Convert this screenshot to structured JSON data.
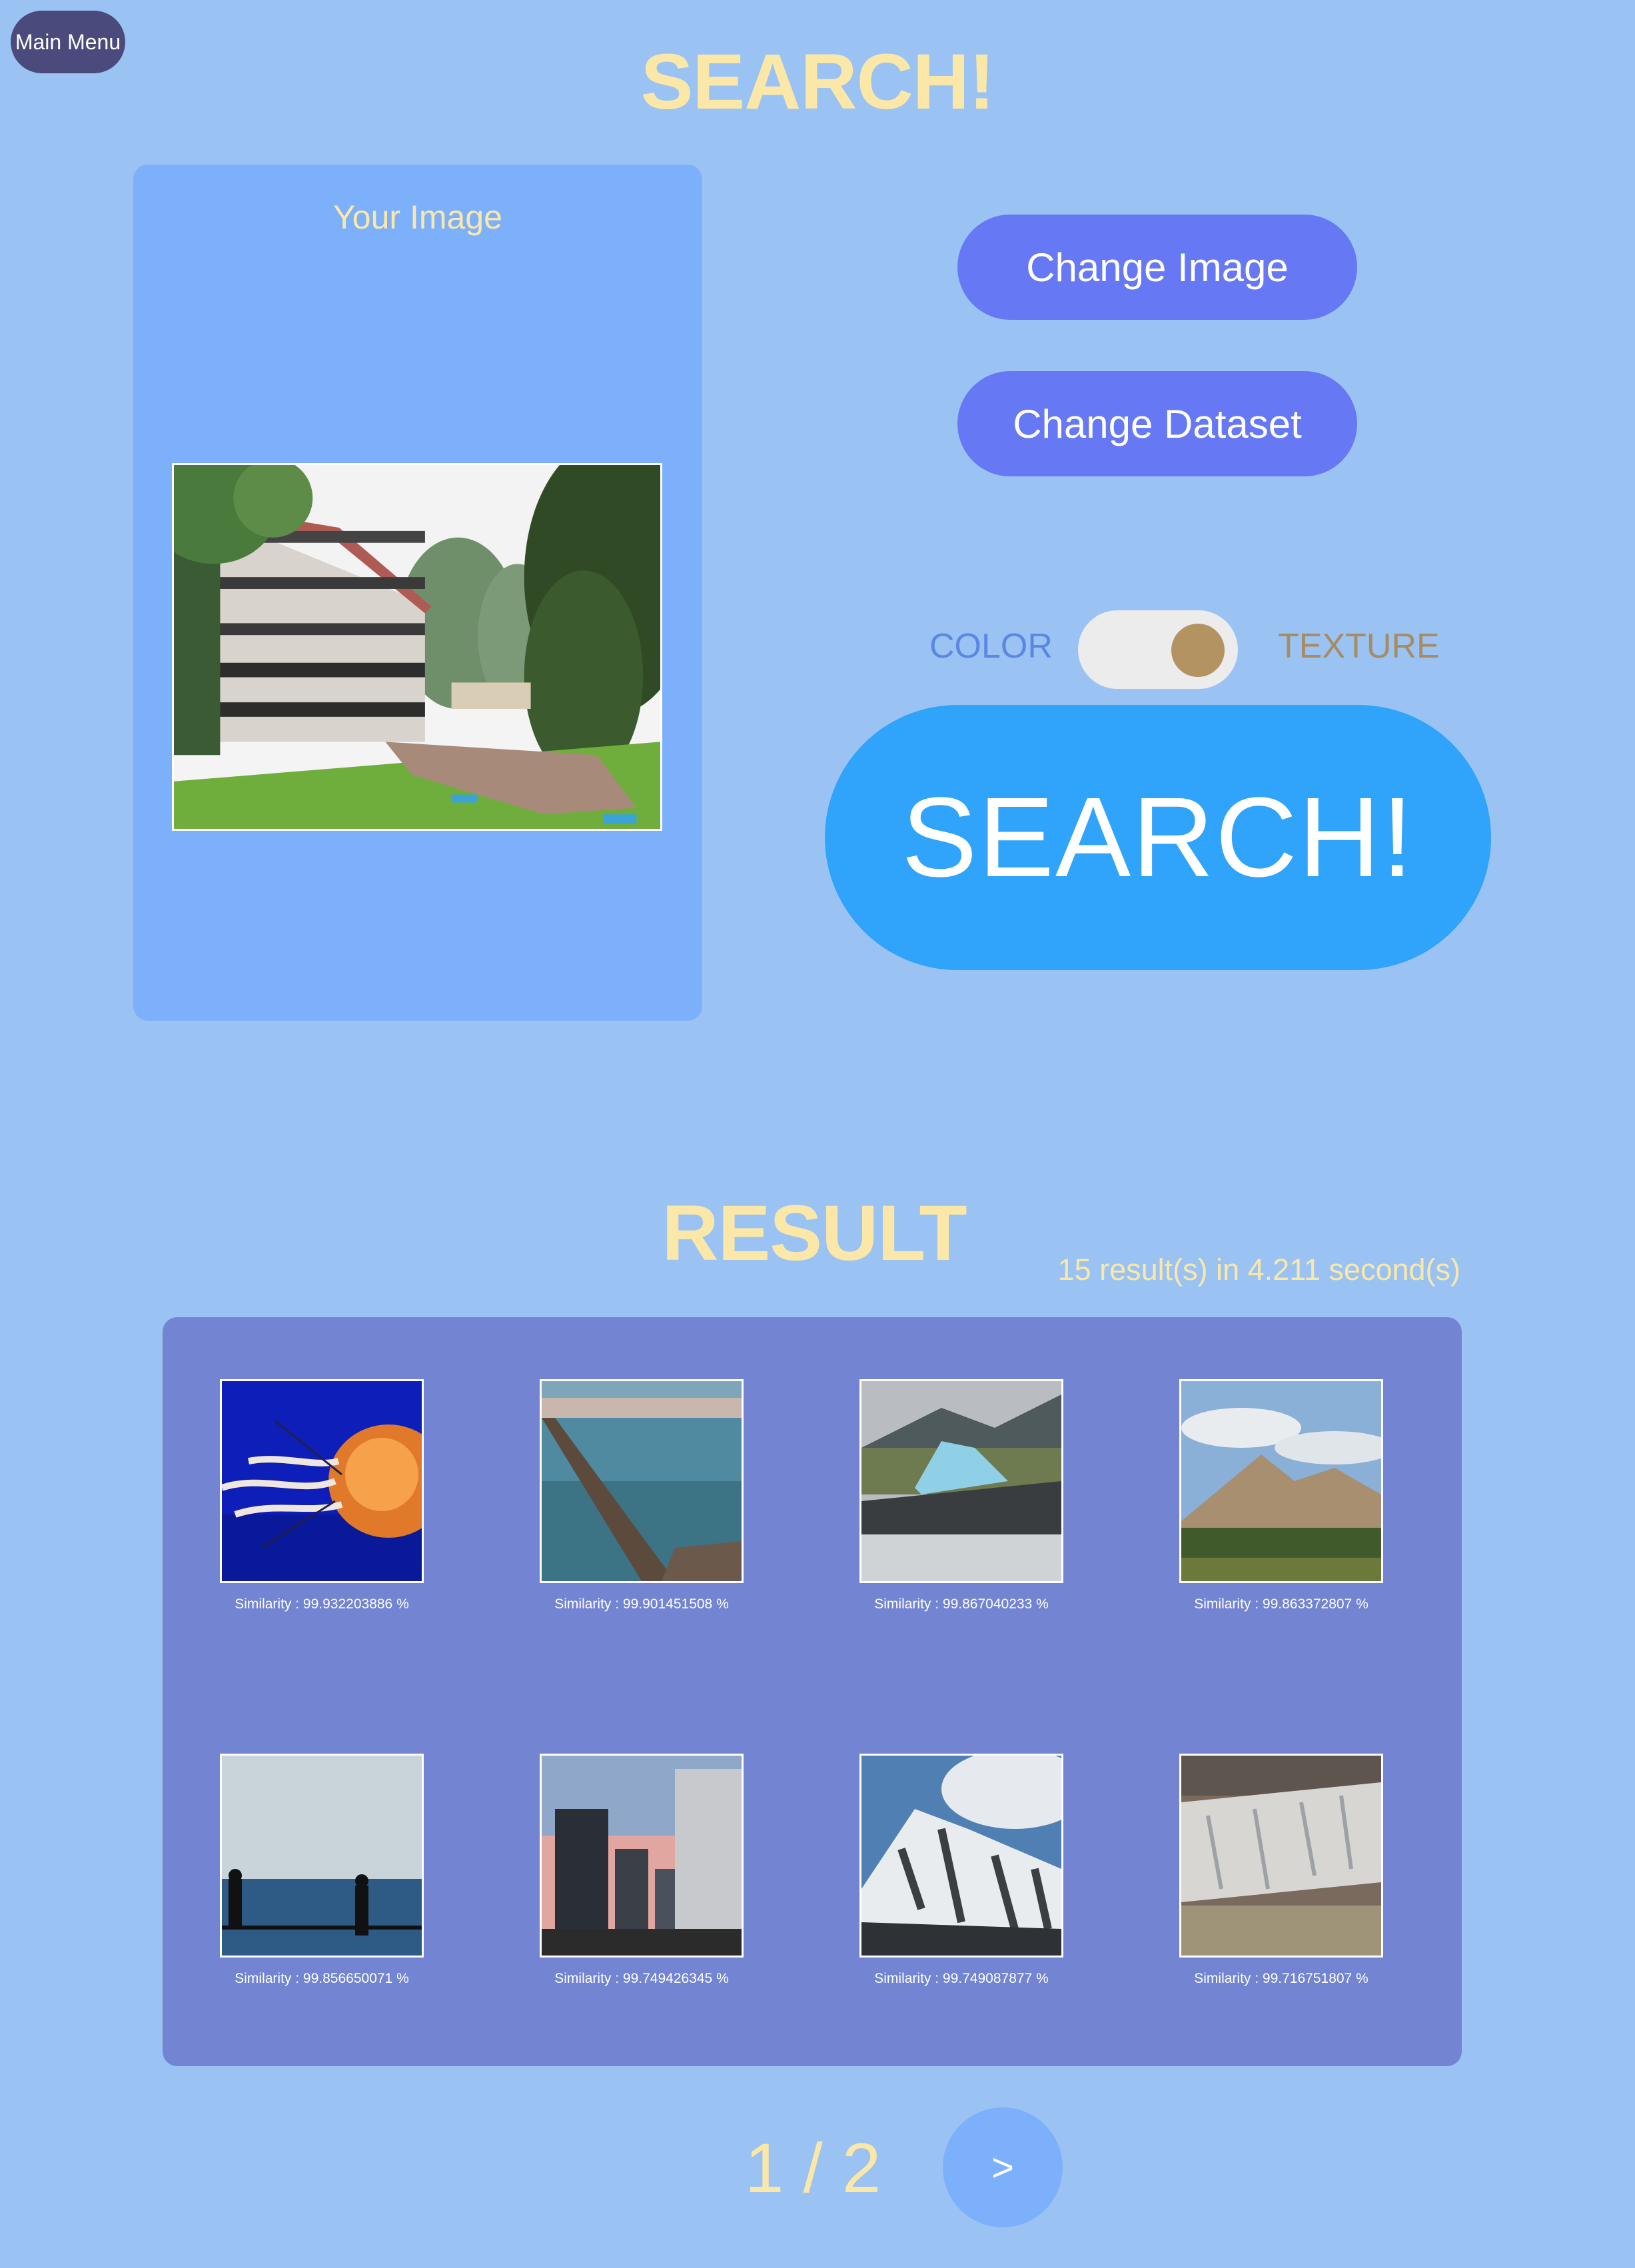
{
  "nav": {
    "main_menu": "Main Menu"
  },
  "page_title": "SEARCH!",
  "query": {
    "label": "Your Image"
  },
  "buttons": {
    "change_image": "Change Image",
    "change_dataset": "Change Dataset",
    "search": "SEARCH!",
    "next": ">"
  },
  "toggle": {
    "left": "COLOR",
    "right": "TEXTURE",
    "selected": "TEXTURE"
  },
  "result": {
    "title": "RESULT",
    "summary": "15 result(s) in 4.211 second(s)",
    "items": [
      {
        "image": "jellyfish",
        "similarity": "Similarity : 99.932203886 %"
      },
      {
        "image": "sea-breakwater",
        "similarity": "Similarity : 99.901451508 %"
      },
      {
        "image": "glacier-lagoon",
        "similarity": "Similarity : 99.867040233 %"
      },
      {
        "image": "mountain-range",
        "similarity": "Similarity : 99.863372807 %"
      },
      {
        "image": "seaside-silhouettes",
        "similarity": "Similarity : 99.856650071 %"
      },
      {
        "image": "city-skyscrapers",
        "similarity": "Similarity : 99.749426345 %"
      },
      {
        "image": "snowy-mountain",
        "similarity": "Similarity : 99.749087877 %"
      },
      {
        "image": "glacier-river",
        "similarity": "Similarity : 99.716751807 %"
      }
    ]
  },
  "pagination": {
    "indicator": "1 / 2"
  },
  "colors": {
    "background": "#9ac3f4",
    "title": "#fbe8a8",
    "panel": "#7db0fb",
    "results_panel": "#7384d2",
    "pill_button": "#6678f4",
    "search_button": "#30a3fb",
    "main_menu": "#4a4a7c"
  }
}
